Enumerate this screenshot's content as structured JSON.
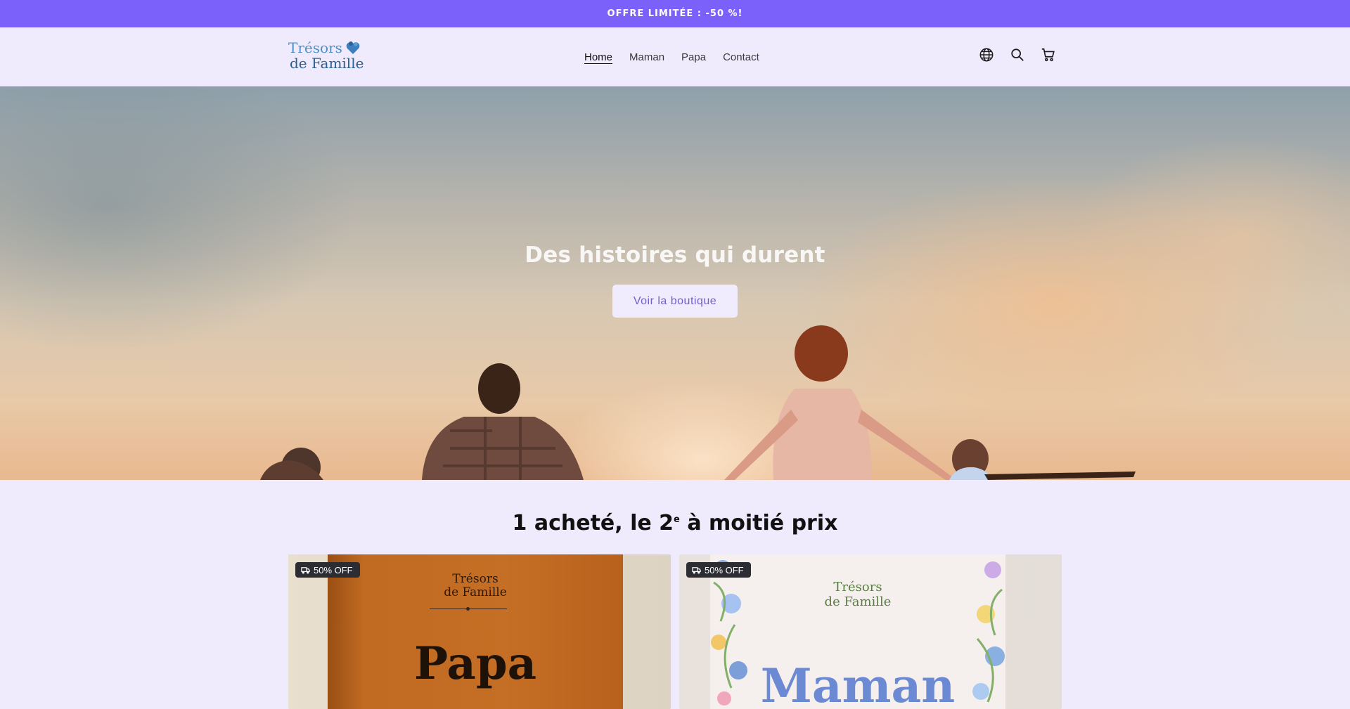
{
  "announcement": {
    "text": "OFFRE LIMITÉE : -50 %!"
  },
  "header": {
    "logo": {
      "line1": "Trésors",
      "line2": "de Famille"
    },
    "nav": [
      {
        "label": "Home",
        "active": true
      },
      {
        "label": "Maman"
      },
      {
        "label": "Papa"
      },
      {
        "label": "Contact"
      }
    ],
    "icons": [
      "globe-icon",
      "search-icon",
      "cart-icon"
    ]
  },
  "hero": {
    "title": "Des histoires qui durent",
    "button_label": "Voir la boutique"
  },
  "promo": {
    "title_before": "1 acheté, le 2",
    "title_sup": "e",
    "title_after": " à moitié prix"
  },
  "products": [
    {
      "badge": "50% OFF",
      "brand_line1": "Trésors",
      "brand_line2": "de Famille",
      "name": "Papa"
    },
    {
      "badge": "50% OFF",
      "brand_line1": "Trésors",
      "brand_line2": "de Famille",
      "name": "Maman"
    }
  ],
  "colors": {
    "accent": "#7b61fa",
    "background": "#efebfd",
    "button_text": "#7160c8",
    "badge_bg": "#2b2d33"
  }
}
